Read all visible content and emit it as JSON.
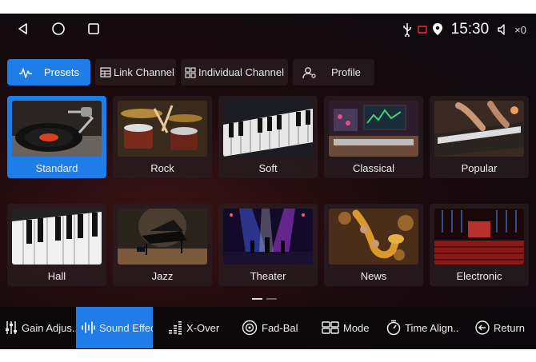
{
  "status": {
    "time": "15:30",
    "volume": "×0"
  },
  "nav": {
    "back_icon": "back-triangle-icon",
    "home_icon": "home-circle-icon",
    "recents_icon": "recents-square-icon"
  },
  "tabs": [
    {
      "label": "Presets",
      "icon": "waveform-icon",
      "active": true
    },
    {
      "label": "Link Channel",
      "icon": "link-channel-icon",
      "active": false
    },
    {
      "label": "Individual Channel",
      "icon": "grid-icon",
      "active": false
    },
    {
      "label": "Profile",
      "icon": "user-icon",
      "active": false
    }
  ],
  "presets": [
    {
      "label": "Standard",
      "active": true
    },
    {
      "label": "Rock"
    },
    {
      "label": "Soft"
    },
    {
      "label": "Classical"
    },
    {
      "label": "Popular"
    },
    {
      "label": "Hall"
    },
    {
      "label": "Jazz"
    },
    {
      "label": "Theater"
    },
    {
      "label": "News"
    },
    {
      "label": "Electronic"
    }
  ],
  "page_indicator": {
    "current": 1,
    "total": 2
  },
  "bottom": [
    {
      "label": "Gain Adjus...",
      "icon": "sliders-icon"
    },
    {
      "label": "Sound Effec",
      "icon": "sound-bars-icon",
      "active": true
    },
    {
      "label": "X-Over",
      "icon": "xover-bars-icon"
    },
    {
      "label": "Fad-Bal",
      "icon": "speaker-target-icon"
    },
    {
      "label": "Mode",
      "icon": "mode-icon"
    },
    {
      "label": "Time Align..",
      "icon": "timer-icon"
    },
    {
      "label": "Return",
      "icon": "return-arrow-icon"
    }
  ],
  "colors": {
    "accent": "#1e7de8",
    "background": "#1a0a0d"
  }
}
